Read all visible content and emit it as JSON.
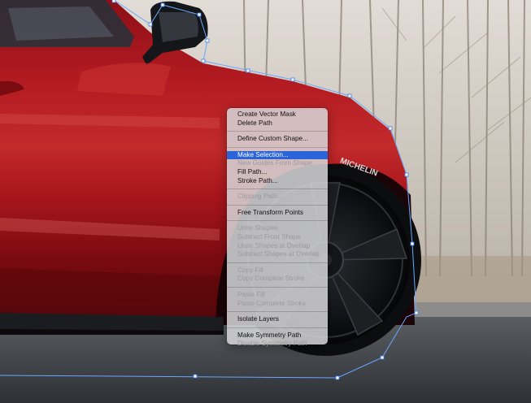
{
  "context_menu": {
    "groups": [
      [
        {
          "label": "Create Vector Mask",
          "enabled": true
        },
        {
          "label": "Delete Path",
          "enabled": true
        }
      ],
      [
        {
          "label": "Define Custom Shape...",
          "enabled": true
        }
      ],
      [
        {
          "label": "Make Selection...",
          "enabled": true,
          "highlighted": true
        },
        {
          "label": "New Guides From Shape",
          "enabled": false
        },
        {
          "label": "Fill Path...",
          "enabled": true
        },
        {
          "label": "Stroke Path...",
          "enabled": true
        }
      ],
      [
        {
          "label": "Clipping Path...",
          "enabled": false
        }
      ],
      [
        {
          "label": "Free Transform Points",
          "enabled": true
        }
      ],
      [
        {
          "label": "Unite Shapes",
          "enabled": false
        },
        {
          "label": "Subtract Front Shape",
          "enabled": false
        },
        {
          "label": "Unite Shapes at Overlap",
          "enabled": false
        },
        {
          "label": "Subtract Shapes at Overlap",
          "enabled": false
        }
      ],
      [
        {
          "label": "Copy Fill",
          "enabled": false
        },
        {
          "label": "Copy Complete Stroke",
          "enabled": false
        }
      ],
      [
        {
          "label": "Paste Fill",
          "enabled": false
        },
        {
          "label": "Paste Complete Stroke",
          "enabled": false
        }
      ],
      [
        {
          "label": "Isolate Layers",
          "enabled": true
        }
      ],
      [
        {
          "label": "Make Symmetry Path",
          "enabled": true
        },
        {
          "label": "Disable Symmetry Path",
          "enabled": false
        }
      ]
    ]
  },
  "tire_brand": "MICHELIN",
  "colors": {
    "car_red": "#a5121a",
    "highlight": "#2a64d8",
    "path_line": "#6aa8ff"
  }
}
